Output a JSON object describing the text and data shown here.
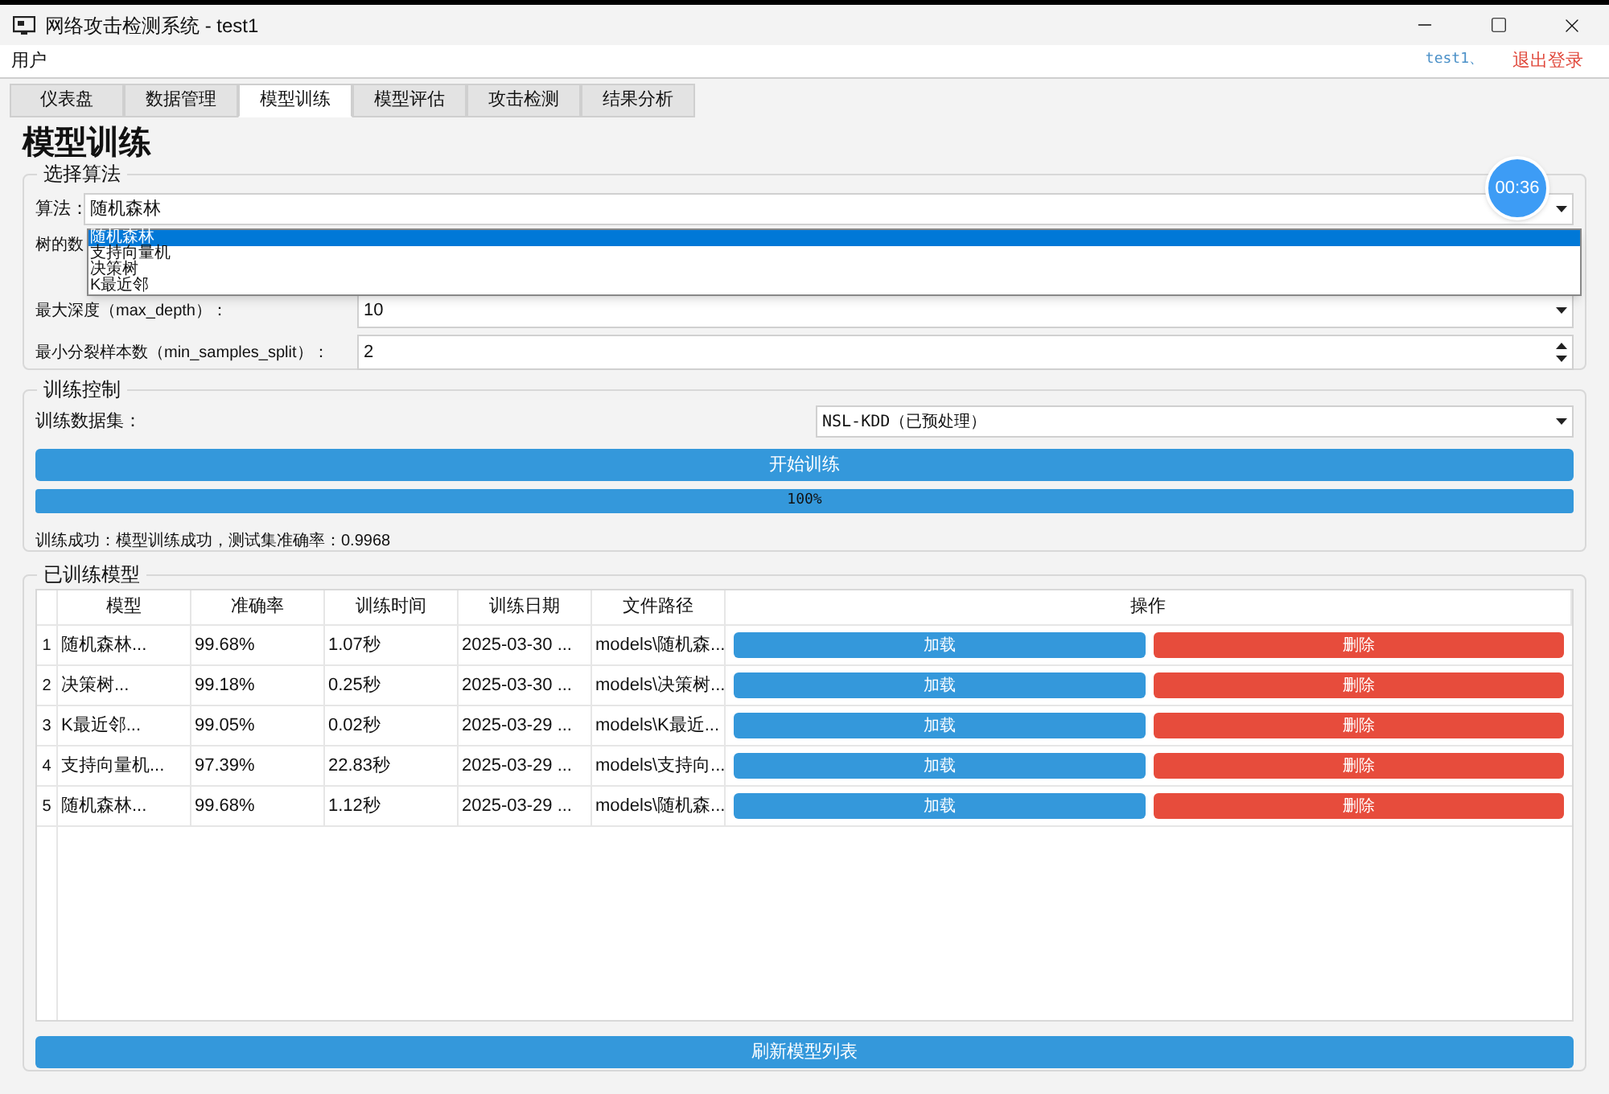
{
  "window": {
    "title": "网络攻击检测系统 - test1"
  },
  "menu": [
    "用户"
  ],
  "user": {
    "name": "test1、",
    "logout": "退出登录"
  },
  "tabs": [
    {
      "label": "仪表盘",
      "selected": false
    },
    {
      "label": "数据管理",
      "selected": false
    },
    {
      "label": "模型训练",
      "selected": true
    },
    {
      "label": "模型评估",
      "selected": false
    },
    {
      "label": "攻击检测",
      "selected": false
    },
    {
      "label": "结果分析",
      "selected": false
    }
  ],
  "heading": "模型训练",
  "algorithm_group": {
    "title": "选择算法",
    "algorithm": {
      "label": "算法：",
      "value": "随机森林",
      "options": [
        {
          "label": "随机森林",
          "selected": true
        },
        {
          "label": "支持向量机",
          "selected": false
        },
        {
          "label": "决策树",
          "selected": false
        },
        {
          "label": "K最近邻",
          "selected": false
        }
      ]
    },
    "n_estimators": {
      "label": "树的数"
    },
    "max_depth": {
      "label": "最大深度（max_depth）：",
      "value": "10"
    },
    "min_samples_split": {
      "label": "最小分裂样本数（min_samples_split）：",
      "value": "2"
    }
  },
  "timer": "00:36",
  "training": {
    "title": "训练控制",
    "dataset_label": "训练数据集：",
    "dataset": "NSL-KDD（已预处理）",
    "start_button": "开始训练",
    "progress": {
      "level": 1,
      "text": "100%"
    },
    "status": "训练成功：模型训练成功，测试集准确率：0.9968"
  },
  "models": {
    "title": "已训练模型",
    "columns": [
      "模型",
      "准确率",
      "训练时间",
      "训练日期",
      "文件路径",
      "操作"
    ],
    "rows": [
      {
        "index": "1",
        "cells": [
          "随机森林...",
          "99.68%",
          "1.07秒",
          "2025-03-30 ...",
          "models\\随机森..."
        ],
        "load": "加载",
        "delete": "删除"
      },
      {
        "index": "2",
        "cells": [
          "决策树...",
          "99.18%",
          "0.25秒",
          "2025-03-30 ...",
          "models\\决策树..."
        ],
        "load": "加载",
        "delete": "删除"
      },
      {
        "index": "3",
        "cells": [
          "K最近邻...",
          "99.05%",
          "0.02秒",
          "2025-03-29 ...",
          "models\\K最近..."
        ],
        "load": "加载",
        "delete": "删除"
      },
      {
        "index": "4",
        "cells": [
          "支持向量机...",
          "97.39%",
          "22.83秒",
          "2025-03-29 ...",
          "models\\支持向..."
        ],
        "load": "加载",
        "delete": "删除"
      },
      {
        "index": "5",
        "cells": [
          "随机森林...",
          "99.68%",
          "1.12秒",
          "2025-03-29 ...",
          "models\\随机森..."
        ],
        "load": "加载",
        "delete": "删除"
      }
    ],
    "refresh_button": "刷新模型列表"
  }
}
